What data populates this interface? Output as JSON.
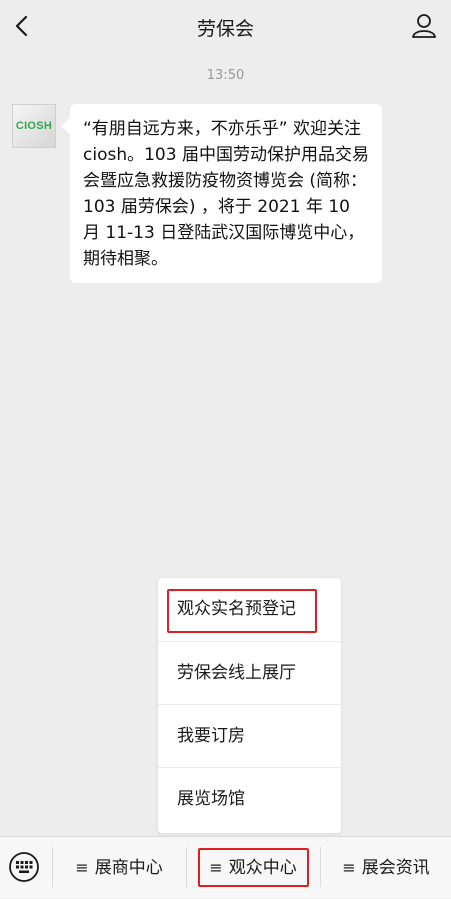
{
  "header": {
    "title": "劳保会"
  },
  "chat": {
    "time": "13:50",
    "avatar_text": "CIOSH",
    "message": "“有朋自远方来，不亦乐乎” 欢迎关注 ciosh。103 届中国劳动保护用品交易会暨应急救援防疫物资博览会 (简称：103 届劳保会) ，将于 2021 年 10 月 11-13 日登陆武汉国际博览中心，期待相聚。"
  },
  "popup_menu": {
    "items": [
      "观众实名预登记",
      "劳保会线上展厅",
      "我要订房",
      "展览场馆"
    ]
  },
  "bottom_menu": {
    "items": [
      {
        "label": "展商中心"
      },
      {
        "label": "观众中心"
      },
      {
        "label": "展会资讯"
      }
    ],
    "menu_glyph": "≡"
  },
  "colors": {
    "highlight": "#e02020",
    "background": "#ededed"
  }
}
